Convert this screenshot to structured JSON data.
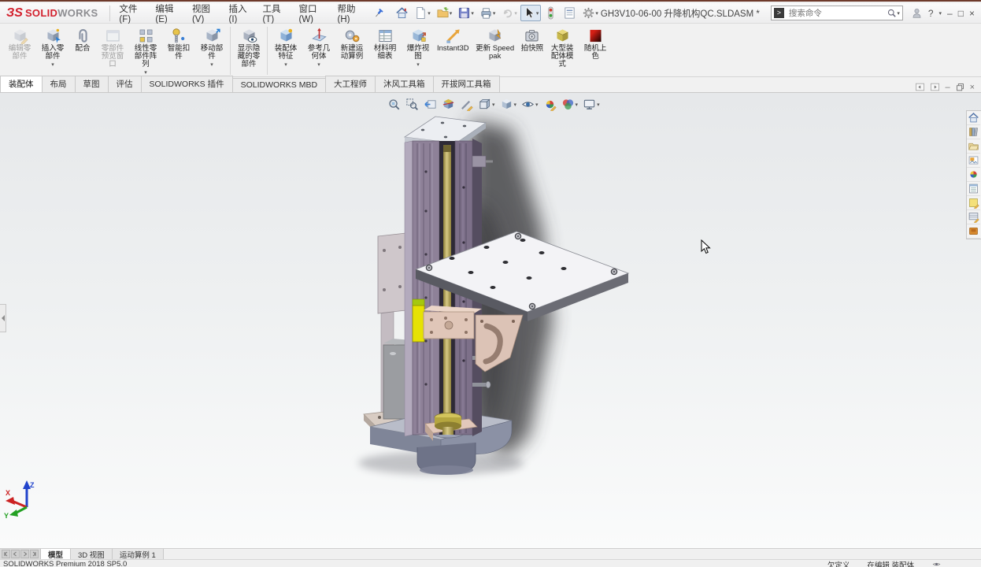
{
  "titlebar": {
    "logo_mark": "ЗS",
    "logo_solid": "SOLID",
    "logo_works": "WORKS",
    "document_title": "GH3V10-06-00 升降机构QC.SLDASM *",
    "search_placeholder": "搜索命令",
    "help_label": "?",
    "controls": {
      "minimize": "–",
      "maximize": "□",
      "close": "×"
    }
  },
  "menu": {
    "items": [
      "文件(F)",
      "编辑(E)",
      "视图(V)",
      "插入(I)",
      "工具(T)",
      "窗口(W)",
      "帮助(H)"
    ]
  },
  "quick_toolbar": [
    {
      "icon": "home"
    },
    {
      "icon": "new-doc",
      "dropdown": true
    },
    {
      "icon": "open-folder",
      "dropdown": true
    },
    {
      "icon": "save",
      "dropdown": true
    },
    {
      "icon": "print",
      "dropdown": true
    },
    {
      "icon": "undo",
      "dropdown": true,
      "disabled": true
    },
    {
      "icon": "select-arrow",
      "dropdown": true,
      "active": true
    },
    {
      "icon": "rebuild-traffic-light"
    },
    {
      "icon": "file-properties"
    },
    {
      "icon": "options-gear",
      "dropdown": true
    }
  ],
  "ribbon": {
    "buttons": [
      {
        "label": "编辑零部件",
        "icon": "edit-component",
        "disabled": true
      },
      {
        "label": "插入零部件",
        "icon": "insert-component",
        "dropdown": true
      },
      {
        "label": "配合",
        "icon": "mate"
      },
      {
        "label": "零部件预览窗口",
        "icon": "preview-window",
        "disabled": true
      },
      {
        "label": "线性零部件阵列",
        "icon": "linear-pattern",
        "dropdown": true
      },
      {
        "label": "智能扣件",
        "icon": "smart-fasteners"
      },
      {
        "label": "移动部件",
        "icon": "move-component",
        "dropdown": true
      },
      {
        "label": "显示隐藏的零部件",
        "icon": "show-hidden",
        "sep_before": true
      },
      {
        "label": "装配体特征",
        "icon": "assembly-features",
        "dropdown": true,
        "sep_before": true
      },
      {
        "label": "参考几何体",
        "icon": "reference-geometry",
        "dropdown": true
      },
      {
        "label": "新建运动算例",
        "icon": "motion-study"
      },
      {
        "label": "材料明细表",
        "icon": "bom"
      },
      {
        "label": "爆炸视图",
        "icon": "exploded-view",
        "dropdown": true
      },
      {
        "label": "Instant3D",
        "icon": "instant3d"
      },
      {
        "label": "更新 Speedpak",
        "icon": "speedpak"
      },
      {
        "label": "拍快照",
        "icon": "snapshot"
      },
      {
        "label": "大型装配体模式",
        "icon": "large-assembly"
      },
      {
        "label": "随机上色",
        "icon": "random-color"
      }
    ]
  },
  "command_tabs": [
    {
      "label": "装配体",
      "active": true
    },
    {
      "label": "布局"
    },
    {
      "label": "草图"
    },
    {
      "label": "评估"
    },
    {
      "label": "SOLIDWORKS 插件"
    },
    {
      "label": "SOLIDWORKS MBD"
    },
    {
      "label": "大工程师"
    },
    {
      "label": "沐风工具箱"
    },
    {
      "label": "开拔网工具箱"
    }
  ],
  "heads_up": [
    {
      "icon": "zoom-fit"
    },
    {
      "icon": "zoom-area"
    },
    {
      "icon": "previous-view"
    },
    {
      "icon": "section-view"
    },
    {
      "icon": "sketch-tools"
    },
    {
      "icon": "view-orientation",
      "dropdown": true
    },
    {
      "icon": "display-style",
      "dropdown": true
    },
    {
      "icon": "hide-show-items",
      "dropdown": true
    },
    {
      "icon": "edit-appearance"
    },
    {
      "icon": "apply-scene",
      "dropdown": true
    },
    {
      "icon": "view-settings",
      "dropdown": true
    }
  ],
  "task_pane": [
    {
      "icon": "resources-home"
    },
    {
      "icon": "design-library"
    },
    {
      "icon": "file-explorer"
    },
    {
      "icon": "view-palette"
    },
    {
      "icon": "appearances"
    },
    {
      "icon": "custom-properties"
    },
    {
      "icon": "notes"
    },
    {
      "icon": "forum"
    },
    {
      "icon": "toolbox-addin"
    }
  ],
  "triad": {
    "x": "X",
    "y": "Y",
    "z": "Z"
  },
  "bottom_tabs": [
    {
      "label": "模型",
      "active": true
    },
    {
      "label": "3D 视图"
    },
    {
      "label": "运动算例 1"
    }
  ],
  "status_bar": {
    "left": "SOLIDWORKS Premium 2018 SP5.0",
    "under_defined": "欠定义",
    "editing": "在编辑 装配体"
  },
  "colors": {
    "brand_red": "#d21f2c",
    "viewport_gradient_top": "#e6e8ea",
    "viewport_gradient_bottom": "#fafbfb",
    "model_column_purple": "#8e8198",
    "model_screw_gold": "#a89a4a",
    "model_platform_white": "#f3f3f6",
    "model_bracket_pink": "#dcc3b6",
    "model_highlight_yellow": "#e6e203",
    "model_base_gray": "#878da0",
    "triad_x": "#cc2222",
    "triad_y": "#22a022",
    "triad_z": "#2244cc"
  }
}
